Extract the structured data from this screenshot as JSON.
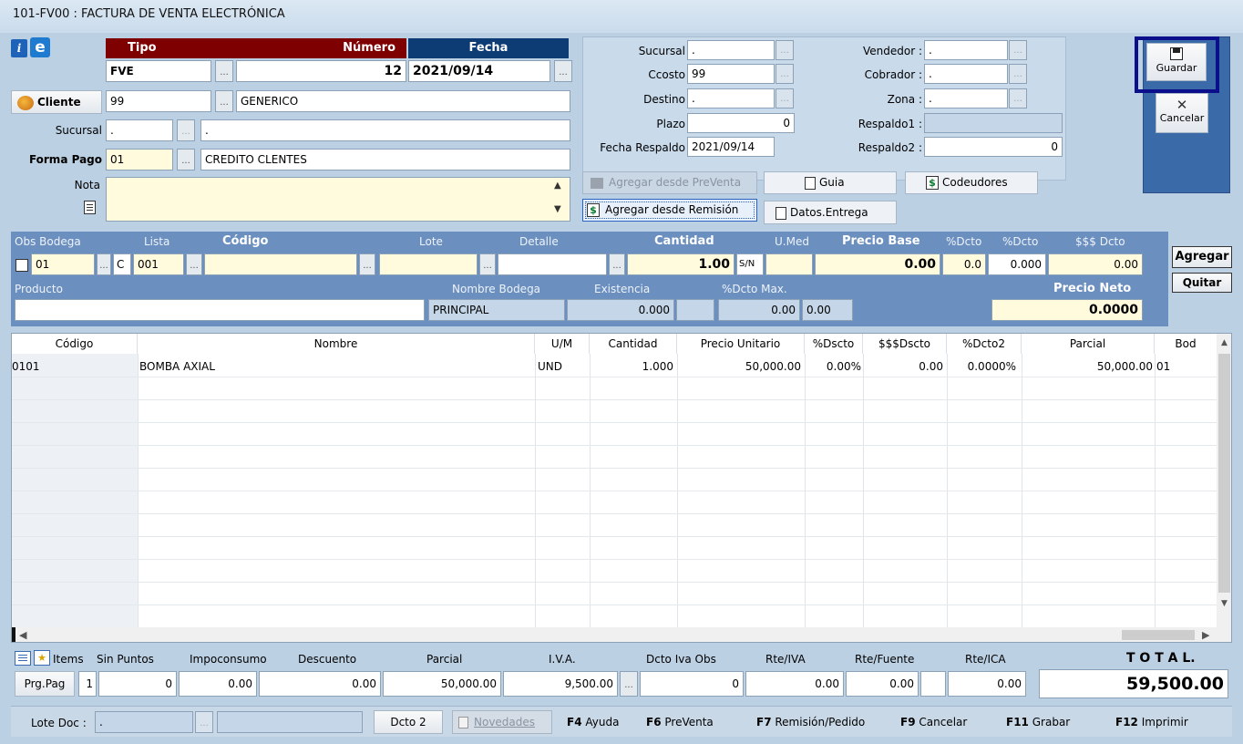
{
  "window": {
    "title": "101-FV00 : FACTURA DE VENTA ELECTRÓNICA"
  },
  "header": {
    "tipo_label": "Tipo",
    "numero_label": "Número",
    "fecha_label": "Fecha",
    "tipo": "FVE",
    "numero": "12",
    "fecha": "2021/09/14",
    "cliente_label": "Cliente",
    "cliente_code": "99",
    "cliente_name": "GENERICO",
    "sucursal_label": "Sucursal",
    "sucursal_code": ".",
    "sucursal_name": ".",
    "forma_pago_label": "Forma Pago",
    "forma_pago_code": "01",
    "forma_pago_name": "CREDITO CLENTES",
    "nota_label": "Nota",
    "nota": ""
  },
  "panel": {
    "sucursal_label": "Sucursal",
    "sucursal": ".",
    "ccosto_label": "Ccosto",
    "ccosto": "99",
    "destino_label": "Destino",
    "destino": ".",
    "plazo_label": "Plazo",
    "plazo": "0",
    "fecha_respaldo_label": "Fecha Respaldo",
    "fecha_respaldo": "2021/09/14",
    "vendedor_label": "Vendedor :",
    "vendedor": ".",
    "cobrador_label": "Cobrador :",
    "cobrador": ".",
    "zona_label": "Zona :",
    "zona": ".",
    "respaldo1_label": "Respaldo1 :",
    "respaldo1": "",
    "respaldo2_label": "Respaldo2 :",
    "respaldo2": "0"
  },
  "actions": {
    "agregar_preventa": "Agregar desde PreVenta",
    "agregar_remision": "Agregar desde Remisión",
    "guia": "Guia",
    "codeudores": "Codeudores",
    "datos_entrega": "Datos.Entrega",
    "guardar": "Guardar",
    "cancelar": "Cancelar"
  },
  "item_entry": {
    "obs_bodega_label": "Obs Bodega",
    "lista_label": "Lista",
    "codigo_label": "Código",
    "lote_label": "Lote",
    "detalle_label": "Detalle",
    "cantidad_label": "Cantidad",
    "umed_label": "U.Med",
    "precio_base_label": "Precio Base",
    "dcto1_label": "%Dcto",
    "dcto2_label": "%Dcto",
    "dcto_money_label": "$$$ Dcto",
    "bodega": "01",
    "lista_c": "C",
    "lista": "001",
    "codigo": "",
    "lote": "",
    "detalle": "",
    "cantidad": "1.00",
    "sn": "S/N",
    "umed": "",
    "precio_base": "0.00",
    "dcto1": "0.0",
    "dcto2": "0.000",
    "dcto_money": "0.00",
    "producto_label": "Producto",
    "nombre_bodega_label": "Nombre Bodega",
    "existencia_label": "Existencia",
    "dcto_max_label": "%Dcto Max.",
    "precio_neto_label": "Precio Neto",
    "producto": "",
    "nombre_bodega": "PRINCIPAL",
    "existencia": "0.000",
    "dcto_max": "0.00",
    "dcto_max2": "0.00",
    "precio_neto": "0.0000",
    "agregar": "Agregar",
    "quitar": "Quitar"
  },
  "grid": {
    "columns": [
      "Código",
      "Nombre",
      "U/M",
      "Cantidad",
      "Precio Unitario",
      "%Dscto",
      "$$$Dscto",
      "%Dcto2",
      "Parcial",
      "Bod"
    ],
    "rows": [
      {
        "codigo": "0101",
        "nombre": "BOMBA AXIAL",
        "um": "UND",
        "cantidad": "1.000",
        "precio": "50,000.00",
        "dscto": "0.00%",
        "dscto_money": "0.00",
        "dcto2": "0.0000%",
        "parcial": "50,000.00",
        "bod": "01"
      }
    ]
  },
  "totals": {
    "items_label": "Items",
    "sin_puntos_label": "Sin Puntos",
    "impoconsumo_label": "Impoconsumo",
    "descuento_label": "Descuento",
    "parcial_label": "Parcial",
    "iva_label": "I.V.A.",
    "dcto_iva_obs_label": "Dcto Iva Obs",
    "rte_iva_label": "Rte/IVA",
    "rte_fuente_label": "Rte/Fuente",
    "rte_ica_label": "Rte/ICA",
    "total_label": "T O T A L.",
    "prg_pag": "Prg.Pag",
    "items": "1",
    "sin_puntos": "0",
    "impoconsumo": "0.00",
    "descuento": "0.00",
    "parcial": "50,000.00",
    "iva": "9,500.00",
    "dcto_iva_obs": "0",
    "rte_iva": "0.00",
    "rte_fuente": "0.00",
    "rte_ica": "0.00",
    "total": "59,500.00"
  },
  "statusbar": {
    "lote_doc_label": "Lote Doc :",
    "lote_doc": ".",
    "dcto2": "Dcto 2",
    "novedades": "Novedades",
    "f4_key": "F4",
    "f4": "Ayuda",
    "f6_key": "F6",
    "f6": "PreVenta",
    "f7_key": "F7",
    "f7": "Remisión/Pedido",
    "f9_key": "F9",
    "f9": "Cancelar",
    "f11_key": "F11",
    "f11": "Grabar",
    "f12_key": "F12",
    "f12": "Imprimir"
  },
  "colors": {
    "tipo_bar": "#7f0000",
    "fecha_bar": "#0d3b73",
    "item_bar": "#6b8fbf",
    "toolbar": "#3b6aa8"
  }
}
